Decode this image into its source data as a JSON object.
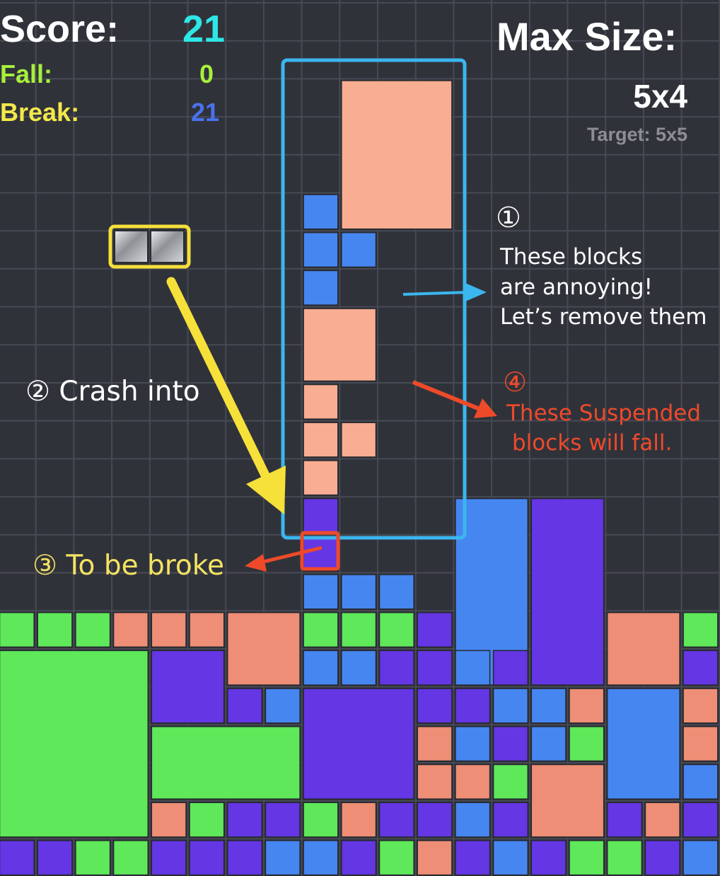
{
  "hud": {
    "score_label": "Score:",
    "score_value": "21",
    "fall_label": "Fall:",
    "fall_value": "0",
    "break_label": "Break:",
    "break_value": "21",
    "max_size_label": "Max Size:",
    "max_size_value": "5x4",
    "target_text": "Target: 5x5"
  },
  "annotations": {
    "note1_number": "①",
    "note1_line1": "These blocks",
    "note1_line2": "are annoying!",
    "note1_line3": "Let’s remove them",
    "note2": "② Crash into",
    "note3": "③ To be broke",
    "note4_number": "④",
    "note4_line1": "These Suspended",
    "note4_line2": "blocks will fall."
  },
  "colors": {
    "background": "#30323a",
    "grid_line": "#474a54",
    "score_value": "#2ee6e6",
    "fall": "#a6f03a",
    "break_label": "#f3e84a",
    "break_value": "#4a72ee",
    "blue_highlight": "#3cb6ee",
    "yellow_highlight": "#f6e03a",
    "red_highlight": "#ee4a2a",
    "block_green": "#5ee85a",
    "block_salmon": "#ee8e76",
    "block_purple": "#6436e4",
    "block_blue": "#4686f0",
    "block_peach": "#f9ad92",
    "block_steel": "#c3c6cc"
  },
  "icons": {
    "falling_piece": "steel-block-pair",
    "arrow1": "blue-arrow",
    "arrow2": "yellow-arrow",
    "arrow3": "red-arrow",
    "arrow4": "red-arrow"
  }
}
